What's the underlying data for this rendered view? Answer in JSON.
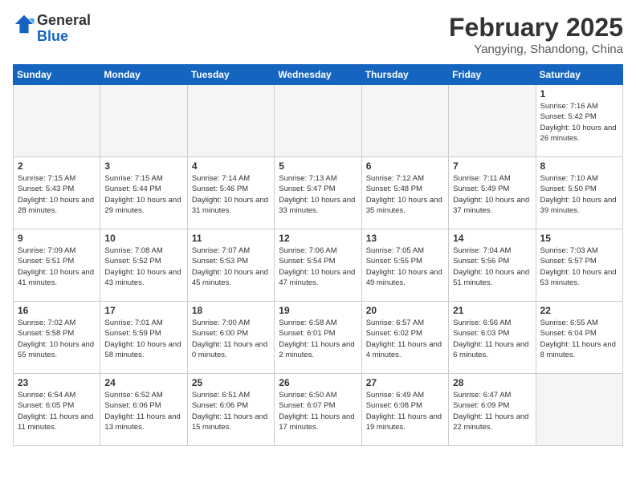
{
  "header": {
    "logo_line1": "General",
    "logo_line2": "Blue",
    "month": "February 2025",
    "location": "Yangying, Shandong, China"
  },
  "weekdays": [
    "Sunday",
    "Monday",
    "Tuesday",
    "Wednesday",
    "Thursday",
    "Friday",
    "Saturday"
  ],
  "weeks": [
    [
      {
        "day": "",
        "info": ""
      },
      {
        "day": "",
        "info": ""
      },
      {
        "day": "",
        "info": ""
      },
      {
        "day": "",
        "info": ""
      },
      {
        "day": "",
        "info": ""
      },
      {
        "day": "",
        "info": ""
      },
      {
        "day": "1",
        "info": "Sunrise: 7:16 AM\nSunset: 5:42 PM\nDaylight: 10 hours and 26 minutes."
      }
    ],
    [
      {
        "day": "2",
        "info": "Sunrise: 7:15 AM\nSunset: 5:43 PM\nDaylight: 10 hours and 28 minutes."
      },
      {
        "day": "3",
        "info": "Sunrise: 7:15 AM\nSunset: 5:44 PM\nDaylight: 10 hours and 29 minutes."
      },
      {
        "day": "4",
        "info": "Sunrise: 7:14 AM\nSunset: 5:46 PM\nDaylight: 10 hours and 31 minutes."
      },
      {
        "day": "5",
        "info": "Sunrise: 7:13 AM\nSunset: 5:47 PM\nDaylight: 10 hours and 33 minutes."
      },
      {
        "day": "6",
        "info": "Sunrise: 7:12 AM\nSunset: 5:48 PM\nDaylight: 10 hours and 35 minutes."
      },
      {
        "day": "7",
        "info": "Sunrise: 7:11 AM\nSunset: 5:49 PM\nDaylight: 10 hours and 37 minutes."
      },
      {
        "day": "8",
        "info": "Sunrise: 7:10 AM\nSunset: 5:50 PM\nDaylight: 10 hours and 39 minutes."
      }
    ],
    [
      {
        "day": "9",
        "info": "Sunrise: 7:09 AM\nSunset: 5:51 PM\nDaylight: 10 hours and 41 minutes."
      },
      {
        "day": "10",
        "info": "Sunrise: 7:08 AM\nSunset: 5:52 PM\nDaylight: 10 hours and 43 minutes."
      },
      {
        "day": "11",
        "info": "Sunrise: 7:07 AM\nSunset: 5:53 PM\nDaylight: 10 hours and 45 minutes."
      },
      {
        "day": "12",
        "info": "Sunrise: 7:06 AM\nSunset: 5:54 PM\nDaylight: 10 hours and 47 minutes."
      },
      {
        "day": "13",
        "info": "Sunrise: 7:05 AM\nSunset: 5:55 PM\nDaylight: 10 hours and 49 minutes."
      },
      {
        "day": "14",
        "info": "Sunrise: 7:04 AM\nSunset: 5:56 PM\nDaylight: 10 hours and 51 minutes."
      },
      {
        "day": "15",
        "info": "Sunrise: 7:03 AM\nSunset: 5:57 PM\nDaylight: 10 hours and 53 minutes."
      }
    ],
    [
      {
        "day": "16",
        "info": "Sunrise: 7:02 AM\nSunset: 5:58 PM\nDaylight: 10 hours and 55 minutes."
      },
      {
        "day": "17",
        "info": "Sunrise: 7:01 AM\nSunset: 5:59 PM\nDaylight: 10 hours and 58 minutes."
      },
      {
        "day": "18",
        "info": "Sunrise: 7:00 AM\nSunset: 6:00 PM\nDaylight: 11 hours and 0 minutes."
      },
      {
        "day": "19",
        "info": "Sunrise: 6:58 AM\nSunset: 6:01 PM\nDaylight: 11 hours and 2 minutes."
      },
      {
        "day": "20",
        "info": "Sunrise: 6:57 AM\nSunset: 6:02 PM\nDaylight: 11 hours and 4 minutes."
      },
      {
        "day": "21",
        "info": "Sunrise: 6:56 AM\nSunset: 6:03 PM\nDaylight: 11 hours and 6 minutes."
      },
      {
        "day": "22",
        "info": "Sunrise: 6:55 AM\nSunset: 6:04 PM\nDaylight: 11 hours and 8 minutes."
      }
    ],
    [
      {
        "day": "23",
        "info": "Sunrise: 6:54 AM\nSunset: 6:05 PM\nDaylight: 11 hours and 11 minutes."
      },
      {
        "day": "24",
        "info": "Sunrise: 6:52 AM\nSunset: 6:06 PM\nDaylight: 11 hours and 13 minutes."
      },
      {
        "day": "25",
        "info": "Sunrise: 6:51 AM\nSunset: 6:06 PM\nDaylight: 11 hours and 15 minutes."
      },
      {
        "day": "26",
        "info": "Sunrise: 6:50 AM\nSunset: 6:07 PM\nDaylight: 11 hours and 17 minutes."
      },
      {
        "day": "27",
        "info": "Sunrise: 6:49 AM\nSunset: 6:08 PM\nDaylight: 11 hours and 19 minutes."
      },
      {
        "day": "28",
        "info": "Sunrise: 6:47 AM\nSunset: 6:09 PM\nDaylight: 11 hours and 22 minutes."
      },
      {
        "day": "",
        "info": ""
      }
    ]
  ]
}
